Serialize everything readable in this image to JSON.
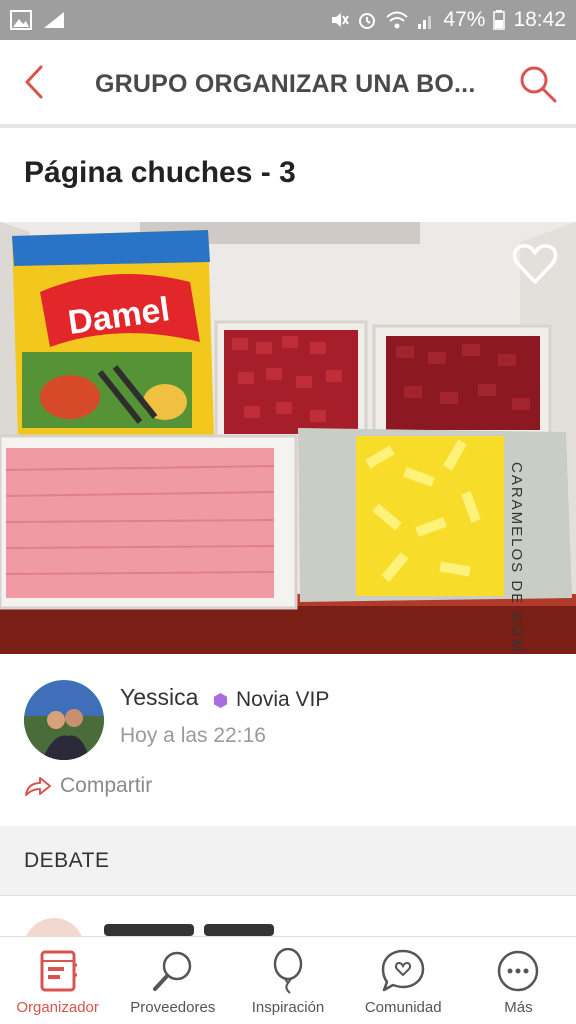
{
  "status_bar": {
    "battery": "47%",
    "time": "18:42",
    "left_icons": [
      "image-icon",
      "signal-strength-icon"
    ],
    "right_icons": [
      "mute-icon",
      "alarm-icon",
      "wifi-icon",
      "cell-signal-icon",
      "battery-icon"
    ]
  },
  "header": {
    "title": "GRUPO ORGANIZAR UNA BO...",
    "back_icon": "chevron-left-icon",
    "search_icon": "search-icon",
    "accent": "#d9534f"
  },
  "post": {
    "title": "Página chuches - 3",
    "favorite_icon": "heart-outline-icon",
    "photo": {
      "package_brand": "Damel",
      "package_label": "CARAMELOS DE GOMA"
    }
  },
  "author": {
    "name": "Yessica",
    "badge": "Novia VIP",
    "badge_color": "#a86ee0",
    "time": "Hoy a las 22:16",
    "share_label": "Compartir"
  },
  "section": {
    "debate_label": "DEBATE"
  },
  "nav": {
    "items": [
      {
        "label": "Organizador",
        "icon": "notebook-icon",
        "active": true
      },
      {
        "label": "Proveedores",
        "icon": "magnifier-icon",
        "active": false
      },
      {
        "label": "Inspiración",
        "icon": "balloon-icon",
        "active": false
      },
      {
        "label": "Comunidad",
        "icon": "chat-heart-icon",
        "active": false
      },
      {
        "label": "Más",
        "icon": "more-dots-icon",
        "active": false
      }
    ],
    "active_color": "#d9534f"
  }
}
